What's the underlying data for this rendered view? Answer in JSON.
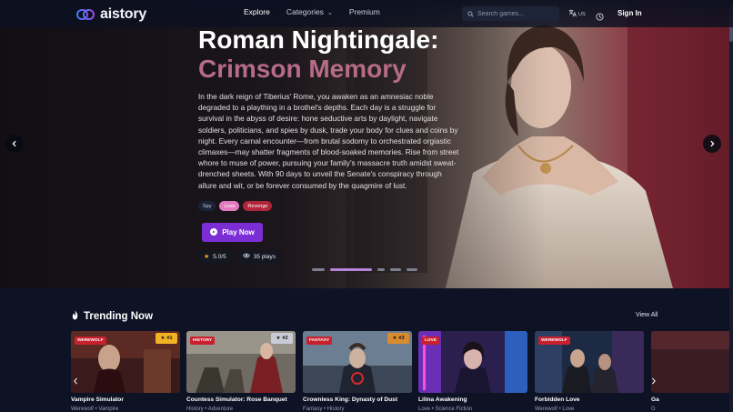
{
  "header": {
    "brand": "aistory",
    "nav": [
      {
        "label": "Explore",
        "active": true
      },
      {
        "label": "Categories",
        "dropdown": true
      },
      {
        "label": "Premium"
      }
    ],
    "search_placeholder": "Search games...",
    "language": "US",
    "sign_in": "Sign In"
  },
  "hero": {
    "title": "Roman Nightingale:",
    "subtitle": "Crimson Memory",
    "description": "In the dark reign of Tiberius' Rome, you awaken as an amnesiac noble degraded to a plaything in a brothel's depths. Each day is a struggle for survival in the abyss of desire: hone seductive arts by daylight, navigate soldiers, politicians, and spies by dusk, trade your body for clues and coins by night. Every carnal encounter—from brutal sodomy to orchestrated orgiastic climaxes—may shatter fragments of blood-soaked memories. Rise from street whore to muse of power, pursuing your family's massacre truth amidst sweat-drenched sheets. With 90 days to unveil the Senate's conspiracy through allure and wit, or be forever consumed by the quagmire of lust.",
    "tags": [
      "Spy",
      "Love",
      "Revenge"
    ],
    "play_label": "Play Now",
    "rating": "5.0/5",
    "plays": "35 plays",
    "slides": 5,
    "active_slide": 1
  },
  "trending": {
    "title": "Trending Now",
    "view_all": "View All",
    "cards": [
      {
        "title": "Vampire Simulator",
        "genre": "WEREWOLF",
        "meta": "Werewolf • Vampire",
        "rank": "#1",
        "rank_color": "#f0b323"
      },
      {
        "title": "Countess Simulator: Rose Banquet",
        "genre": "HISTORY",
        "meta": "History • Adventure",
        "rank": "#2",
        "rank_color": "#c9ccd6"
      },
      {
        "title": "Crownless King: Dynasty of Dust",
        "genre": "FANTASY",
        "meta": "Fantasy • History",
        "rank": "#3",
        "rank_color": "#d98b2f"
      },
      {
        "title": "Lilina Awakening",
        "genre": "LOVE",
        "meta": "Love • Science Fiction",
        "rank": "",
        "rank_color": ""
      },
      {
        "title": "Forbidden Love",
        "genre": "WEREWOLF",
        "meta": "Werewolf • Love",
        "rank": "",
        "rank_color": ""
      },
      {
        "title": "Ga",
        "genre": "",
        "meta": "G",
        "rank": "",
        "rank_color": ""
      }
    ]
  },
  "colors": {
    "accent": "#7b2ed6",
    "subtitle": "#b66b86",
    "background": "#0d1224",
    "genre_badge": "#c9202e"
  }
}
